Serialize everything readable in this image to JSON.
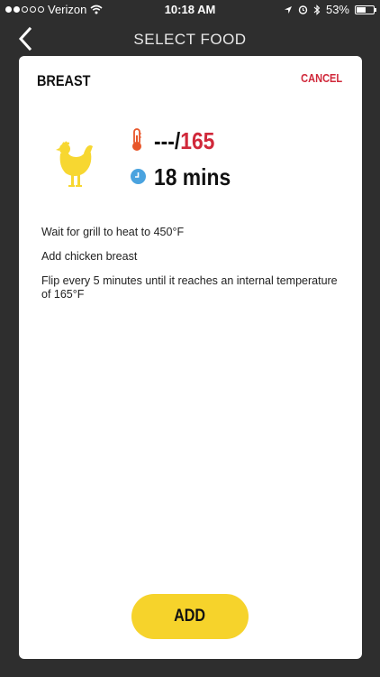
{
  "status_bar": {
    "carrier": "Verizon",
    "time": "10:18 AM",
    "battery_text": "53%",
    "battery_level": 0.53
  },
  "nav": {
    "title": "SELECT FOOD"
  },
  "card": {
    "title": "BREAST",
    "cancel_label": "CANCEL",
    "temp_current": "---",
    "temp_separator": "/",
    "temp_target": "165",
    "time": "18 mins",
    "instructions": [
      "Wait for grill to heat to 450°F",
      "Add chicken breast",
      "Flip every 5 minutes until it reaches an internal temperature of 165°F"
    ],
    "add_label": "ADD"
  },
  "colors": {
    "accent_red": "#d0283a",
    "button_yellow": "#f6d32b",
    "chicken_yellow": "#f7d731",
    "clock_blue": "#4aa3df",
    "thermo_orange": "#e8562a"
  },
  "icons": [
    "signal-dots",
    "wifi-icon",
    "location-icon",
    "alarm-icon",
    "bluetooth-icon",
    "battery-icon",
    "back-icon",
    "chicken-icon",
    "thermometer-icon",
    "clock-icon"
  ]
}
